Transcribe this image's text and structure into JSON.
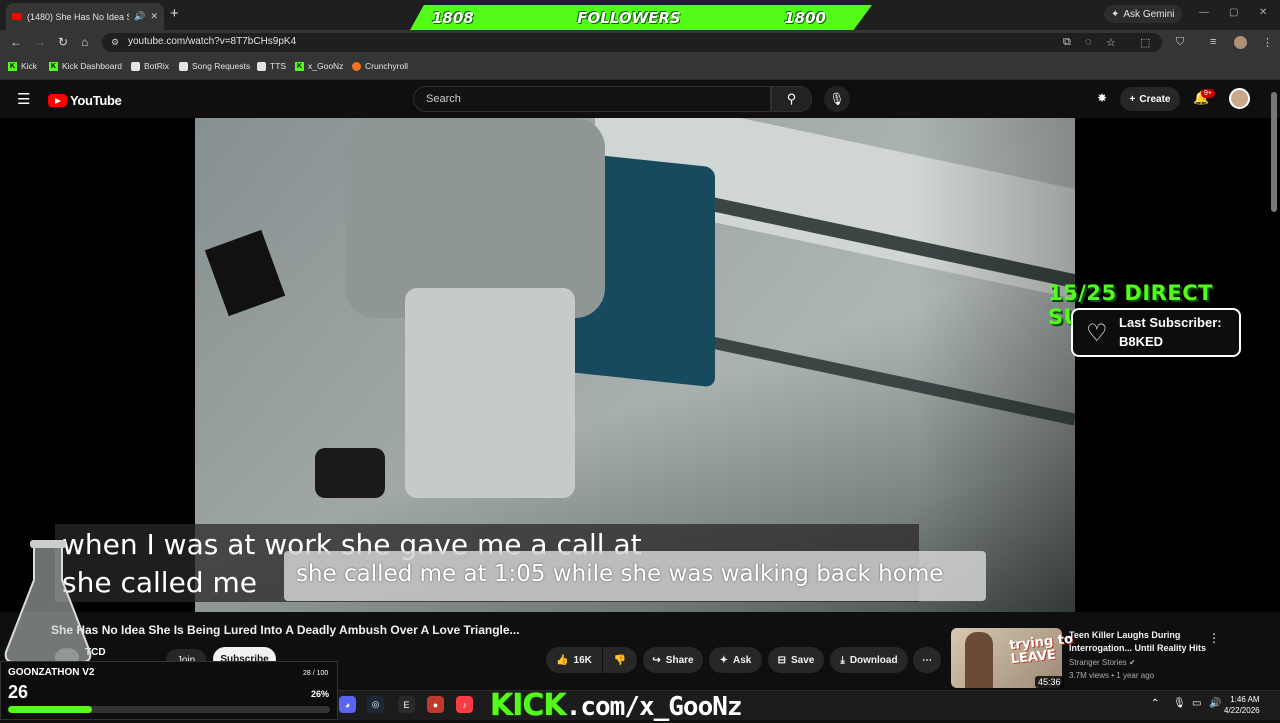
{
  "browser": {
    "tab_title": "(1480) She Has No Idea She",
    "new_tab": "+",
    "ask_gemini": "Ask Gemini",
    "url": "youtube.com/watch?v=8T7bCHs9pK4",
    "bookmarks": [
      {
        "label": "Kick",
        "icon": "kick"
      },
      {
        "label": "Kick Dashboard",
        "icon": "kick"
      },
      {
        "label": "BotRix",
        "icon": "generic"
      },
      {
        "label": "Song Requests",
        "icon": "generic"
      },
      {
        "label": "TTS",
        "icon": "generic"
      },
      {
        "label": "x_GooNz",
        "icon": "kick"
      },
      {
        "label": "Crunchyroll",
        "icon": "crunchyroll"
      }
    ]
  },
  "followers_bar": {
    "left": "1808",
    "label": "FOLLOWERS",
    "right": "1800"
  },
  "youtube": {
    "logo": "YouTube",
    "search_placeholder": "Search",
    "create": "Create",
    "notif_badge": "9+"
  },
  "video": {
    "caption_line1": "when I was at work she gave me a call at",
    "caption_line2": "she called me",
    "caption_line3": "she called me at 1:05 while she was walking back home",
    "title": "She Has No Idea She Is Being Lured Into A Deadly Ambush Over A Love Triangle...",
    "channel": "TCD",
    "join": "Join",
    "subscribe": "Subscribe",
    "likes": "16K",
    "share": "Share",
    "ask": "Ask",
    "save": "Save",
    "download": "Download"
  },
  "overlay": {
    "direct_subs": "15/25 DIRECT SUBS",
    "last_sub_label": "Last Subscriber:",
    "last_sub_name": "B8KED"
  },
  "recommended": {
    "title": "Teen Killer Laughs During Interrogation... Until Reality Hits",
    "channel": "Stranger Stories",
    "views": "3.7M views",
    "age": "1 year ago",
    "duration": "45:36",
    "thumb_text_1": "trying to",
    "thumb_text_2": "LEAVE"
  },
  "goonzathon": {
    "title": "GOONZATHON V2",
    "value": "26",
    "progress_text": "28 / 100",
    "percent": "26%",
    "fill_fraction": 0.26
  },
  "taskbar": {
    "kick_word": "KICK",
    "kick_url": ".com/x_GooNz",
    "time": "1:46 AM",
    "date": "4/22/2026"
  },
  "colors": {
    "kick_green": "#53fc18",
    "yt_red": "#ff0000"
  }
}
